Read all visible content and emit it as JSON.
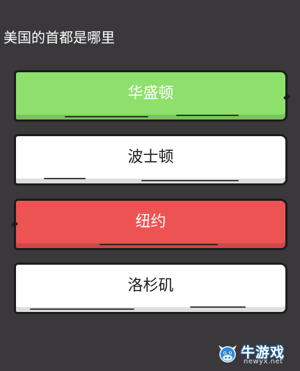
{
  "question": {
    "text": "美国的首都是哪里"
  },
  "answers": [
    {
      "label": "华盛顿",
      "state": "correct",
      "color": "#8ee06d"
    },
    {
      "label": "波士顿",
      "state": "neutral",
      "color": "#ffffff"
    },
    {
      "label": "纽约",
      "state": "wrong",
      "color": "#ee5353"
    },
    {
      "label": "洛杉矶",
      "state": "neutral",
      "color": "#ffffff"
    }
  ],
  "watermark": {
    "main": "牛游戏",
    "sub": "newyx.net",
    "icon": "cow-mascot-icon"
  },
  "colors": {
    "background": "#3a383b",
    "correct": "#8ee06d",
    "wrong": "#ee5353",
    "neutral": "#ffffff",
    "border": "#1c1b1d"
  }
}
